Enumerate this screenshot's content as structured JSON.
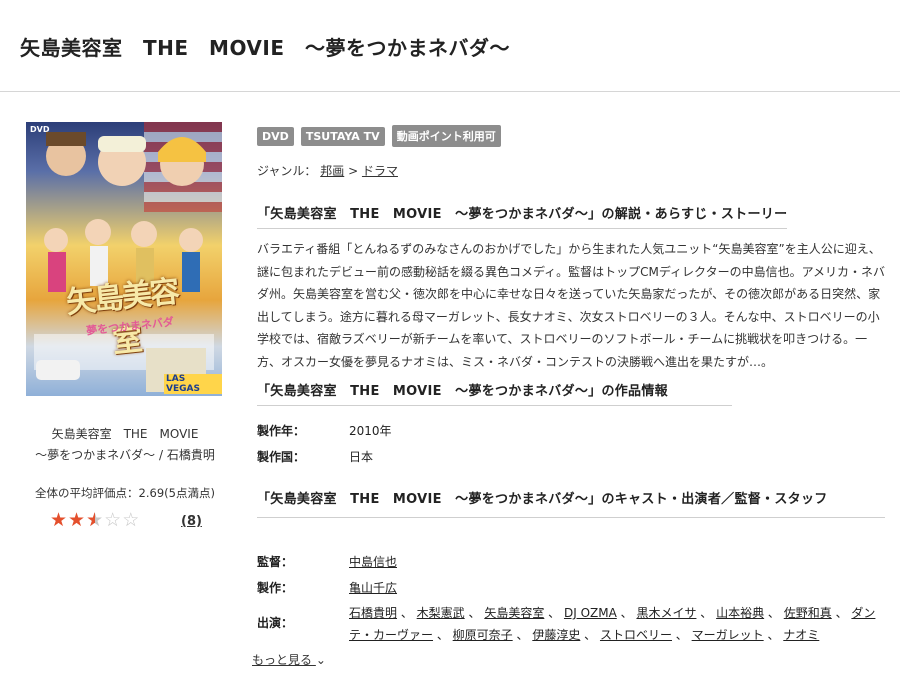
{
  "page": {
    "title": "矢島美容室　THE　MOVIE　〜夢をつかまネバダ〜"
  },
  "left": {
    "caption_line1": "矢島美容室　THE　MOVIE",
    "caption_line2": "〜夢をつかまネバダ〜 / 石橋貴明",
    "rating_text": "全体の平均評価点：2.69(5点満点)",
    "rating_value": 2.69,
    "rating_max": 5,
    "review_count": "(8)",
    "jacket": {
      "logo_text": "矢島美容室",
      "sub_text": "夢をつかまネバダ",
      "dvd_mark": "DVD",
      "sign_text": "LAS VEGAS"
    },
    "colors": {
      "star": "#e4502d",
      "star_empty": "#c8c8c8"
    }
  },
  "badges": [
    "DVD",
    "TSUTAYA TV",
    "動画ポイント利用可"
  ],
  "genre": {
    "label": "ジャンル：",
    "path": [
      "邦画",
      "ドラマ"
    ],
    "separator": " > "
  },
  "synopsis": {
    "heading": "「矢島美容室　THE　MOVIE　〜夢をつかまネバダ〜」の解説・あらすじ・ストーリー",
    "text": "バラエティ番組「とんねるずのみなさんのおかげでした」から生まれた人気ユニット“矢島美容室”を主人公に迎え、謎に包まれたデビュー前の感動秘話を綴る異色コメディ。監督はトップCMディレクターの中島信也。アメリカ・ネバダ州。矢島美容室を営む父・徳次郎を中心に幸せな日々を送っていた矢島家だったが、その徳次郎がある日突然、家出してしまう。途方に暮れる母マーガレット、長女ナオミ、次女ストロベリーの３人。そんな中、ストロベリーの小学校では、宿敵ラズベリーが新チームを率いて、ストロベリーのソフトボール・チームに挑戦状を叩きつける。一方、オスカー女優を夢見るナオミは、ミス・ネバダ・コンテストの決勝戦へ進出を果たすが…。"
  },
  "info": {
    "heading": "「矢島美容室　THE　MOVIE　〜夢をつかまネバダ〜」の作品情報",
    "rows": [
      {
        "label": "製作年：",
        "value": "2010年"
      },
      {
        "label": "製作国：",
        "value": "日本"
      }
    ]
  },
  "cast": {
    "heading": "「矢島美容室　THE　MOVIE　〜夢をつかまネバダ〜」のキャスト・出演者／監督・スタッフ",
    "director_label": "監督：",
    "director": "中島信也",
    "producer_label": "製作：",
    "producer": "亀山千広",
    "actors_label": "出演：",
    "actors": [
      "石橋貴明",
      "木梨憲武",
      "矢島美容室",
      "DJ OZMA",
      "黒木メイサ",
      "山本裕典",
      "佐野和真",
      "ダンテ・カーヴァー",
      "柳原可奈子",
      "伊藤淳史",
      "ストロベリー",
      "マーガレット",
      "ナオミ"
    ],
    "more_label": "もっと見る"
  }
}
